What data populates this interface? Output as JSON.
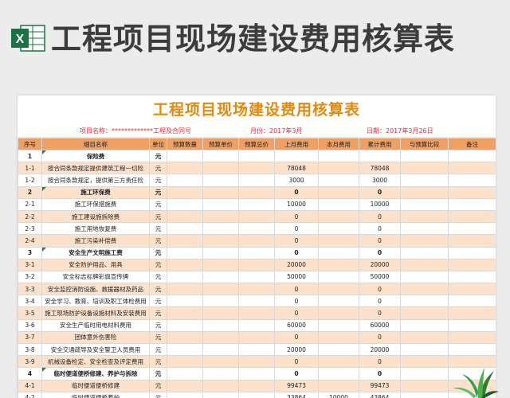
{
  "banner": {
    "title": "工程项目现场建设费用核算表",
    "icon": "excel-logo-icon"
  },
  "sheet": {
    "title": "工程项目现场建设费用核算表",
    "meta": {
      "project": "项目名称：*************工程及合同号",
      "month": "月份：2017年3月",
      "date": "日期：2017年3月26日"
    },
    "columns": [
      "序号",
      "细目名称",
      "单位",
      "预算数量",
      "预算单价",
      "预算总价",
      "上月费用",
      "本月费用",
      "累计费用",
      "与预算比较",
      "备注"
    ],
    "rows": [
      [
        "1",
        "保险费",
        "元",
        "",
        "",
        "",
        "",
        "",
        "",
        "",
        ""
      ],
      [
        "1-1",
        "按合同条款规定提供建筑工程一切险",
        "元",
        "",
        "",
        "",
        "78048",
        "",
        "78048",
        "",
        ""
      ],
      [
        "1-2",
        "按合同条款规定，提供第三方责任险",
        "元",
        "",
        "",
        "",
        "3000",
        "",
        "3000",
        "",
        ""
      ],
      [
        "2",
        "施工环保费",
        "元",
        "",
        "",
        "",
        "0",
        "",
        "0",
        "",
        ""
      ],
      [
        "2-1",
        "施工环保措施费",
        "元",
        "",
        "",
        "",
        "10000",
        "",
        "10000",
        "",
        ""
      ],
      [
        "2-2",
        "施工建设施拆除费",
        "元",
        "",
        "",
        "",
        "0",
        "",
        "0",
        "",
        ""
      ],
      [
        "2-3",
        "施工用地恢复费",
        "元",
        "",
        "",
        "",
        "0",
        "",
        "0",
        "",
        ""
      ],
      [
        "2-4",
        "施工污染补偿费",
        "元",
        "",
        "",
        "",
        "0",
        "",
        "0",
        "",
        ""
      ],
      [
        "3",
        "安全生产文明施工费",
        "元",
        "",
        "",
        "",
        "0",
        "",
        "0",
        "",
        ""
      ],
      [
        "3-1",
        "安全防护用品、用具",
        "元",
        "",
        "",
        "",
        "20000",
        "",
        "20000",
        "",
        ""
      ],
      [
        "3-2",
        "安全标志标牌彩旗宣传牌",
        "元",
        "",
        "",
        "",
        "50000",
        "",
        "50000",
        "",
        ""
      ],
      [
        "3-3",
        "安全监控消防设施、救援器材及药品",
        "元",
        "",
        "",
        "",
        "0",
        "",
        "0",
        "",
        ""
      ],
      [
        "3-4",
        "安全学习、教育、培训及职工体检费用",
        "元",
        "",
        "",
        "",
        "0",
        "",
        "0",
        "",
        ""
      ],
      [
        "3-5",
        "施工现场防护设备设施材料及安装费用",
        "元",
        "",
        "",
        "",
        "0",
        "",
        "0",
        "",
        ""
      ],
      [
        "3-6",
        "安全生产临时用电材料费用",
        "元",
        "",
        "",
        "",
        "60000",
        "",
        "60000",
        "",
        ""
      ],
      [
        "3-7",
        "团体意外伤害险",
        "元",
        "",
        "",
        "",
        "0",
        "",
        "0",
        "",
        ""
      ],
      [
        "3-8",
        "安全交通疏导及安全警卫人员费用",
        "元",
        "",
        "",
        "",
        "20000",
        "",
        "20000",
        "",
        ""
      ],
      [
        "3-9",
        "机械设备检定、安全检查及评定费用",
        "元",
        "",
        "",
        "",
        "0",
        "",
        "0",
        "",
        ""
      ],
      [
        "4",
        "临时便道便桥修建、养护与拆除",
        "元",
        "",
        "",
        "",
        "0",
        "",
        "0",
        "",
        ""
      ],
      [
        "4-1",
        "临时便道便桥修建",
        "元",
        "",
        "",
        "",
        "99473",
        "",
        "99473",
        "",
        ""
      ],
      [
        "4-2",
        "临时便道便桥养护",
        "元",
        "",
        "",
        "",
        "33864",
        "10000",
        "43864",
        "",
        ""
      ],
      [
        "4-3",
        "临时便道便桥拆除",
        "元",
        "",
        "",
        "",
        "0",
        "",
        "0",
        "",
        ""
      ]
    ]
  }
}
